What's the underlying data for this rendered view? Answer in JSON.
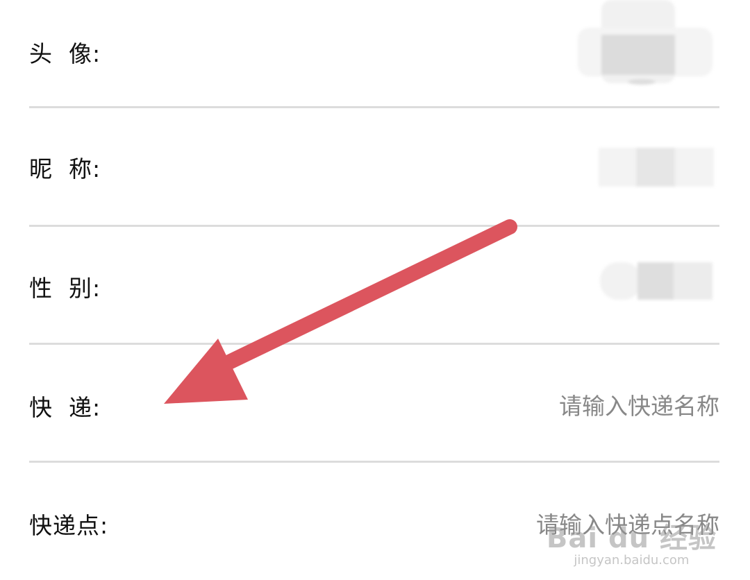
{
  "form": {
    "rows": [
      {
        "label": "头  像:"
      },
      {
        "label": "昵  称:"
      },
      {
        "label": "性  别:"
      },
      {
        "label": "快  递:",
        "placeholder": "请输入快递名称"
      },
      {
        "label": "快递点:",
        "placeholder": "请输入快递点名称"
      }
    ]
  },
  "watermark": {
    "brand": "Bai du 经验",
    "sub": "jingyan.baidu.com"
  },
  "colors": {
    "arrow": "#dc555e",
    "divider": "#dcdcdc",
    "placeholder": "#888888"
  },
  "icons": {
    "annotation": "red-arrow-icon"
  }
}
